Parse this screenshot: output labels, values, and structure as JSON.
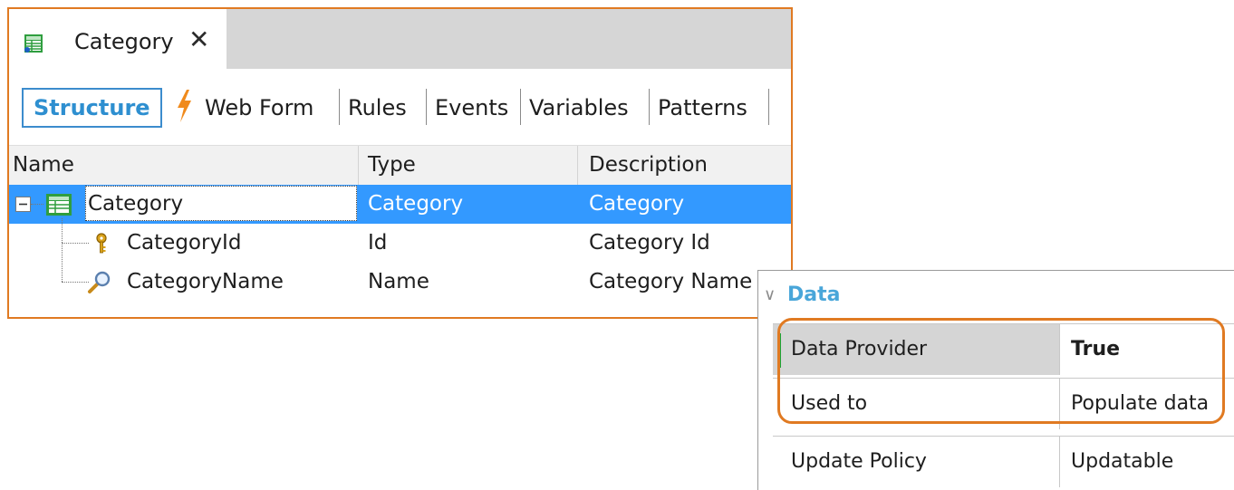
{
  "tab": {
    "title": "Category",
    "close": "✕"
  },
  "toolbar": [
    {
      "label": "Structure",
      "active": true
    },
    {
      "label": "Web Form"
    },
    {
      "label": "Rules"
    },
    {
      "label": "Events"
    },
    {
      "label": "Variables"
    },
    {
      "label": "Patterns"
    }
  ],
  "grid": {
    "headers": {
      "name": "Name",
      "type": "Type",
      "description": "Description"
    },
    "rows": [
      {
        "name": "Category",
        "type": "Category",
        "description": "Category",
        "icon": "transaction-level-icon",
        "selected": true
      },
      {
        "name": "CategoryId",
        "type": "Id",
        "description": "Category Id",
        "icon": "key-icon"
      },
      {
        "name": "CategoryName",
        "type": "Name",
        "description": "Category Name",
        "icon": "descriptor-icon"
      }
    ]
  },
  "properties": {
    "group": "Data",
    "rows": [
      {
        "name": "Data Provider",
        "value": "True"
      },
      {
        "name": "Used to",
        "value": "Populate data"
      },
      {
        "name": "Update Policy",
        "value": "Updatable"
      }
    ]
  },
  "colors": {
    "accent": "#e07a22",
    "selection": "#3399ff",
    "active_tab": "#2e8fd0",
    "group_header": "#49a6d9"
  }
}
